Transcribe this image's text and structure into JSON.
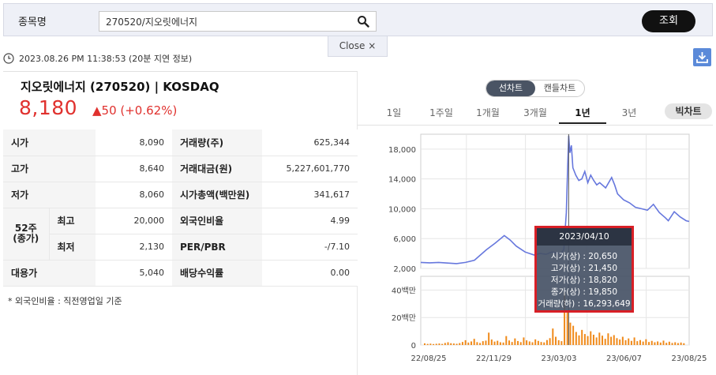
{
  "search": {
    "label": "종목명",
    "value": "270520/지오릿에너지",
    "button": "조회",
    "close_label": "Close ×"
  },
  "timestamp": "2023.08.26 PM 11:38:53 (20분 지연 정보)",
  "stock": {
    "name": "지오릿에너지 (270520) | KOSDAQ",
    "price": "8,180",
    "change": "▲50 (+0.62%)"
  },
  "info_rows": [
    {
      "k1": "시가",
      "v1": "8,090",
      "k2": "거래량(주)",
      "v2": "625,344"
    },
    {
      "k1": "고가",
      "v1": "8,640",
      "k2": "거래대금(원)",
      "v2": "5,227,601,770"
    },
    {
      "k1": "저가",
      "v1": "8,060",
      "k2": "시가총액(백만원)",
      "v2": "341,617"
    },
    {
      "k1": "최고",
      "v1": "20,000",
      "k2": "외국인비율",
      "v2": "4.99"
    },
    {
      "k1": "최저",
      "v1": "2,130",
      "k2": "PER/PBR",
      "v2": "-/7.10"
    },
    {
      "k1": "대용가",
      "v1": "5,040",
      "k2": "배당수익률",
      "v2": "0.00"
    }
  ],
  "week52": "52주\n(종가)",
  "note": "* 외국인비율 : 직전영업일 기준",
  "chart_toggle": {
    "line": "선차트",
    "candle": "캔들차트"
  },
  "periods": [
    "1일",
    "1주일",
    "1개월",
    "3개월",
    "1년",
    "3년"
  ],
  "period_active": 4,
  "big_chart": "빅차트",
  "tooltip": {
    "date": "2023/04/10",
    "rows": [
      "시가(상) : 20,650",
      "고가(상) : 21,450",
      "저가(상) : 18,820",
      "종가(상) : 19,850",
      "거래량(하) : 16,293,649"
    ]
  },
  "chart_data": {
    "type": "line",
    "price_ticks": [
      "18,000",
      "14,000",
      "10,000",
      "6,000",
      "2,000"
    ],
    "volume_ticks": [
      "40백만",
      "20백만",
      "0"
    ],
    "x_ticks": [
      "22/08/25",
      "22/11/29",
      "23/03/03",
      "23/06/07",
      "23/08/25"
    ],
    "ylim": [
      2000,
      20000
    ],
    "vol_max": 50000000,
    "price_series": [
      [
        0,
        2800
      ],
      [
        3,
        2750
      ],
      [
        6,
        2800
      ],
      [
        10,
        2700
      ],
      [
        12,
        2650
      ],
      [
        15,
        2800
      ],
      [
        18,
        3100
      ],
      [
        22,
        4500
      ],
      [
        25,
        5400
      ],
      [
        28,
        6400
      ],
      [
        30,
        5800
      ],
      [
        32,
        5000
      ],
      [
        35,
        4200
      ],
      [
        38,
        3800
      ],
      [
        40,
        4000
      ],
      [
        42,
        3900
      ],
      [
        44,
        4200
      ],
      [
        46,
        4000
      ],
      [
        47,
        3900
      ],
      [
        48,
        4600
      ],
      [
        48.8,
        9500
      ],
      [
        49.2,
        15000
      ],
      [
        49.6,
        19800
      ],
      [
        50,
        17500
      ],
      [
        50.5,
        18500
      ],
      [
        51,
        15500
      ],
      [
        52,
        14500
      ],
      [
        53,
        13800
      ],
      [
        54,
        14000
      ],
      [
        55,
        15000
      ],
      [
        56,
        13500
      ],
      [
        57,
        14500
      ],
      [
        58,
        13800
      ],
      [
        59,
        13200
      ],
      [
        60,
        13500
      ],
      [
        62,
        12800
      ],
      [
        64,
        14200
      ],
      [
        65,
        13200
      ],
      [
        66,
        12000
      ],
      [
        68,
        11200
      ],
      [
        70,
        10800
      ],
      [
        72,
        10200
      ],
      [
        74,
        10000
      ],
      [
        76,
        9800
      ],
      [
        78,
        10600
      ],
      [
        80,
        9500
      ],
      [
        82,
        8800
      ],
      [
        83,
        8400
      ],
      [
        85,
        9600
      ],
      [
        87,
        8900
      ],
      [
        89,
        8400
      ],
      [
        90,
        8300
      ]
    ],
    "volume_bars": [
      1.2,
      0.8,
      1.0,
      0.7,
      0.9,
      1.1,
      0.8,
      1.5,
      2.0,
      1.3,
      1.1,
      0.9,
      1.4,
      2.2,
      3.5,
      1.8,
      2.6,
      4.5,
      2.1,
      1.5,
      2.8,
      3.2,
      9.0,
      4.0,
      2.5,
      3.1,
      2.0,
      1.8,
      6.5,
      3.3,
      2.2,
      4.8,
      2.9,
      2.1,
      5.5,
      3.4,
      2.6,
      2.0,
      4.1,
      3.0,
      2.2,
      1.9,
      3.6,
      5.0,
      12.0,
      6.0,
      3.5,
      2.8,
      38.0,
      25.0,
      16.3,
      14.0,
      9.5,
      7.0,
      11.0,
      8.0,
      6.5,
      10.0,
      7.5,
      5.5,
      9.0,
      6.8,
      4.5,
      8.5,
      6.0,
      7.2,
      5.0,
      4.0,
      6.0,
      3.5,
      4.8,
      3.0,
      5.5,
      2.8,
      3.6,
      2.5,
      4.2,
      2.2,
      3.0,
      2.0,
      2.6,
      1.8,
      3.2,
      1.6,
      2.4,
      1.5,
      2.0,
      1.4,
      1.8,
      1.3
    ],
    "cursor_index": 49.6
  }
}
